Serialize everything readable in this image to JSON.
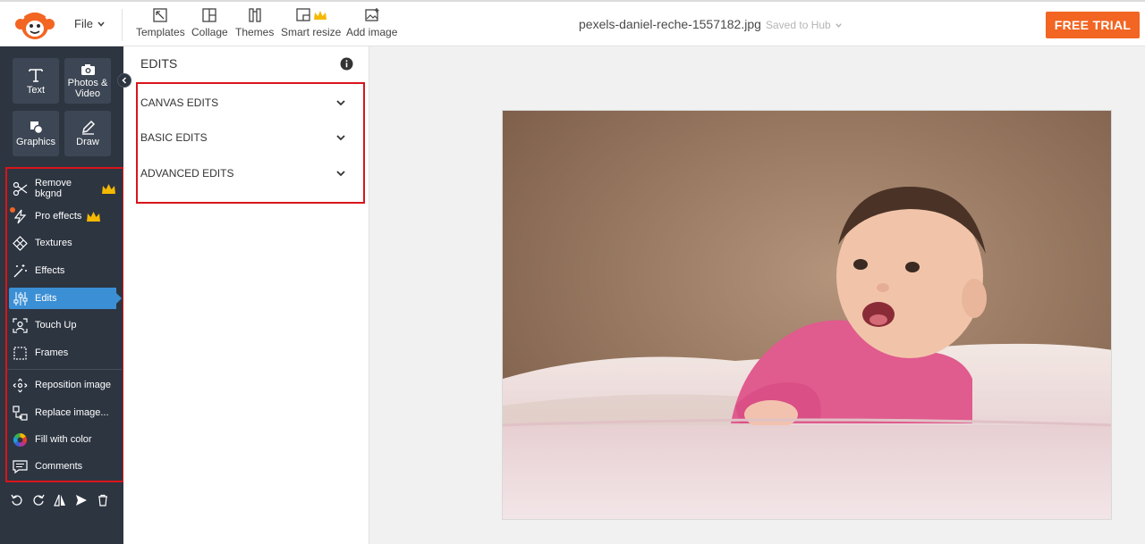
{
  "topbar": {
    "file_label": "File",
    "tools": [
      {
        "label": "Templates",
        "icon": "templates-icon"
      },
      {
        "label": "Collage",
        "icon": "collage-icon"
      },
      {
        "label": "Themes",
        "icon": "themes-icon"
      },
      {
        "label": "Smart resize",
        "icon": "smart-resize-icon"
      },
      {
        "label": "Add image",
        "icon": "add-image-icon"
      }
    ],
    "filename": "pexels-daniel-reche-1557182.jpg",
    "saved_status": "Saved to Hub",
    "free_trial": "FREE TRIAL"
  },
  "sidebar": {
    "big_buttons": [
      {
        "label": "Text",
        "icon": "text-icon"
      },
      {
        "label": "Photos & Video",
        "icon": "camera-icon"
      },
      {
        "label": "Graphics",
        "icon": "graphics-icon"
      },
      {
        "label": "Draw",
        "icon": "pencil-icon"
      }
    ],
    "items": [
      {
        "label": "Remove bkgnd",
        "icon": "scissors-icon",
        "premium": true
      },
      {
        "label": "Pro effects",
        "icon": "lightning-icon",
        "premium": true
      },
      {
        "label": "Textures",
        "icon": "textures-icon"
      },
      {
        "label": "Effects",
        "icon": "magic-wand-icon"
      },
      {
        "label": "Edits",
        "icon": "sliders-icon",
        "active": true
      },
      {
        "label": "Touch Up",
        "icon": "face-icon"
      },
      {
        "label": "Frames",
        "icon": "frame-icon"
      },
      {
        "label": "Reposition image",
        "icon": "reposition-icon"
      },
      {
        "label": "Replace image...",
        "icon": "replace-icon"
      },
      {
        "label": "Fill with color",
        "icon": "color-wheel-icon"
      },
      {
        "label": "Comments",
        "icon": "comment-icon"
      }
    ],
    "bottom_tools": [
      "undo-icon",
      "redo-icon",
      "flip-icon",
      "send-icon",
      "trash-icon"
    ]
  },
  "panel": {
    "title": "EDITS",
    "sections": [
      {
        "label": "CANVAS EDITS"
      },
      {
        "label": "BASIC EDITS"
      },
      {
        "label": "ADVANCED EDITS"
      }
    ]
  },
  "colors": {
    "accent_orange": "#f26522",
    "sidebar_bg": "#2d3541",
    "active_blue": "#3b8fd4",
    "highlight_red": "#d9141b"
  }
}
